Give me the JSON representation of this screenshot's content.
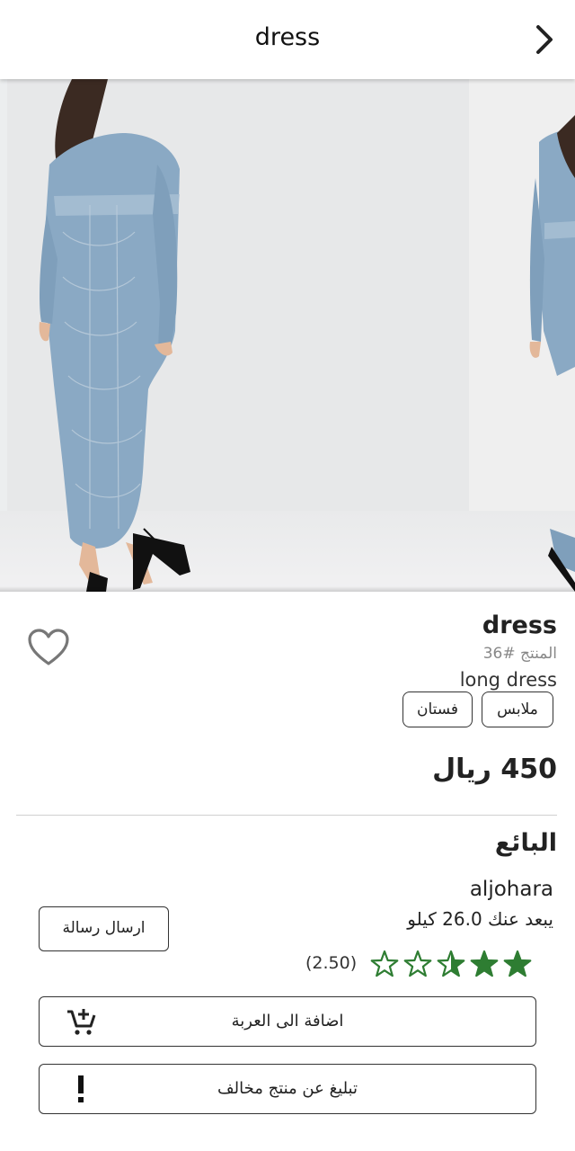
{
  "topbar": {
    "title": "dress"
  },
  "product": {
    "name": "dress",
    "id_label": "المنتج #36",
    "description": "long dress",
    "tags": [
      "ملابس",
      "فستان"
    ],
    "price": "450 ريال"
  },
  "seller": {
    "heading": "البائع",
    "name": "aljohara",
    "distance": "يبعد عنك 26.0 كيلو",
    "message_button": "ارسال رسالة",
    "rating_value": 2.5,
    "rating_text": "(2.50)",
    "rating_max": 5
  },
  "actions": {
    "add_to_cart": "اضافة الى العربة",
    "report": "تبليغ عن منتج مخالف"
  },
  "colors": {
    "star": "#2e7d32",
    "dress": "#8aa9c4"
  }
}
